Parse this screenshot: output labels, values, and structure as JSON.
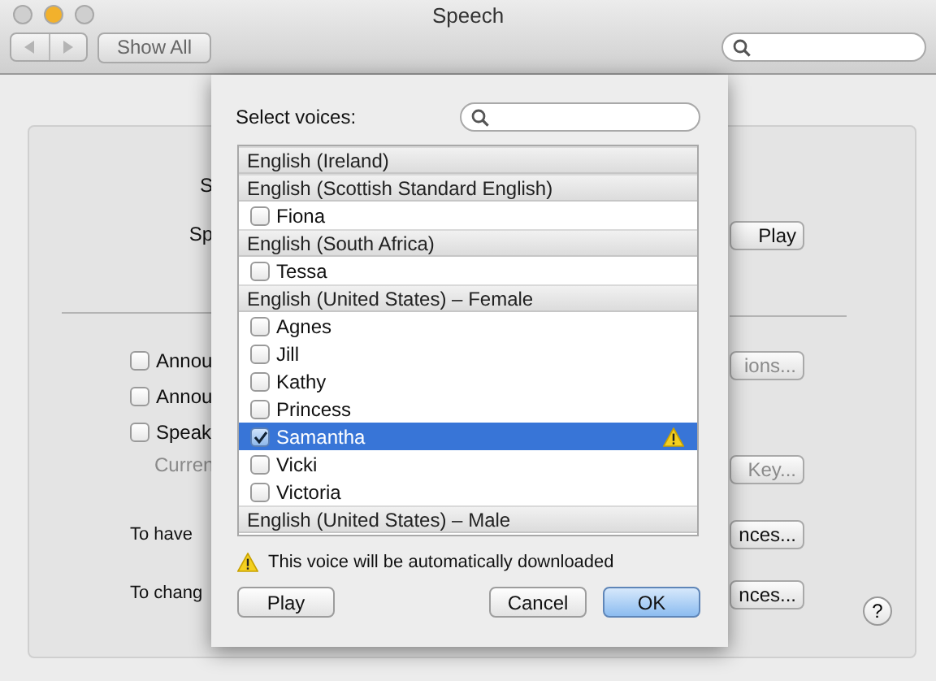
{
  "window": {
    "title": "Speech",
    "controls": [
      {
        "color": "#cfcfcf"
      },
      {
        "color": "#f2b12c"
      },
      {
        "color": "#cfcfcf"
      }
    ]
  },
  "toolbar": {
    "show_all": "Show All"
  },
  "pane": {
    "left_labels": [
      "S",
      "Sp"
    ],
    "checkboxes": [
      {
        "label": "Annou",
        "checked": false
      },
      {
        "label": "Annou",
        "checked": false
      },
      {
        "label": "Speak",
        "checked": false
      }
    ],
    "current": "Curren",
    "to_have": "To have",
    "to_change": "To chang",
    "right_buttons": [
      "Play",
      "ions...",
      "Key...",
      "nces...",
      "nces..."
    ],
    "help": "?"
  },
  "sheet": {
    "label": "Select voices:",
    "groups": [
      {
        "name": "English (Ireland)"
      },
      {
        "name": "English (Scottish Standard English)",
        "voices": [
          {
            "name": "Fiona",
            "checked": false,
            "selected": false,
            "warning": false
          }
        ]
      },
      {
        "name": "English (South Africa)",
        "voices": [
          {
            "name": "Tessa",
            "checked": false,
            "selected": false,
            "warning": false
          }
        ]
      },
      {
        "name": "English (United States) – Female",
        "voices": [
          {
            "name": "Agnes",
            "checked": false,
            "selected": false,
            "warning": false
          },
          {
            "name": "Jill",
            "checked": false,
            "selected": false,
            "warning": false
          },
          {
            "name": "Kathy",
            "checked": false,
            "selected": false,
            "warning": false
          },
          {
            "name": "Princess",
            "checked": false,
            "selected": false,
            "warning": false
          },
          {
            "name": "Samantha",
            "checked": true,
            "selected": true,
            "warning": true
          },
          {
            "name": "Vicki",
            "checked": false,
            "selected": false,
            "warning": false
          },
          {
            "name": "Victoria",
            "checked": false,
            "selected": false,
            "warning": false
          }
        ]
      },
      {
        "name": "English (United States) – Male"
      }
    ],
    "notice": "This voice will be automatically downloaded",
    "buttons": [
      {
        "label": "Play",
        "kind": "normal"
      },
      {
        "label": "Cancel",
        "kind": "normal"
      },
      {
        "label": "OK",
        "kind": "default"
      }
    ]
  }
}
